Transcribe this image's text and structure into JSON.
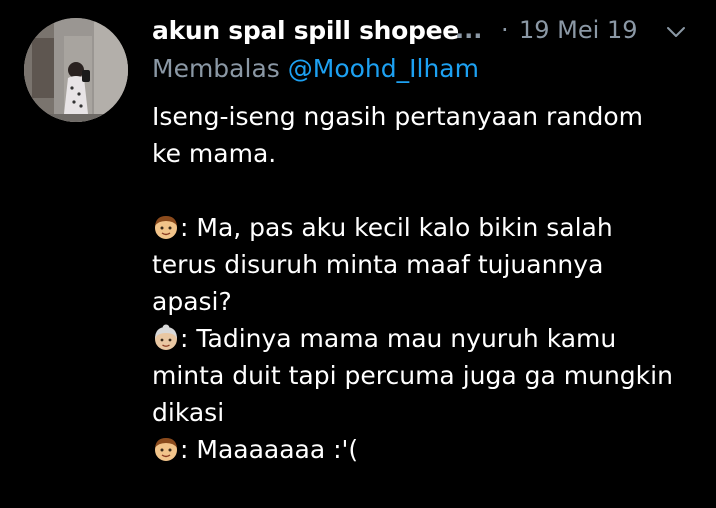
{
  "tweet": {
    "display_name": "akun spal spill shopee",
    "truncation": "...",
    "separator": "·",
    "timestamp": "19 Mei 19",
    "reply_prefix": "Membalas",
    "reply_to": "@Moohd_Ilham",
    "text_lines": [
      "Iseng-iseng ngasih pertanyaan random",
      "ke mama."
    ],
    "dialogue": [
      {
        "speaker_icon": "boy-emoji-icon",
        "text": ": Ma, pas aku kecil kalo bikin salah"
      },
      {
        "text": "terus disuruh minta maaf tujuannya"
      },
      {
        "text": "apasi?"
      },
      {
        "speaker_icon": "older-woman-emoji-icon",
        "text": ": Tadinya mama mau nyuruh kamu"
      },
      {
        "text": "minta duit tapi percuma juga ga mungkin"
      },
      {
        "text": "dikasi"
      },
      {
        "speaker_icon": "boy-emoji-icon",
        "text": ": Maaaaaaa :'("
      }
    ]
  },
  "colors": {
    "background": "#000000",
    "text_primary": "#ffffff",
    "text_secondary": "#8b98a5",
    "link": "#1da1f2"
  },
  "icons": {
    "avatar": "profile-avatar",
    "caret": "chevron-down-icon"
  }
}
